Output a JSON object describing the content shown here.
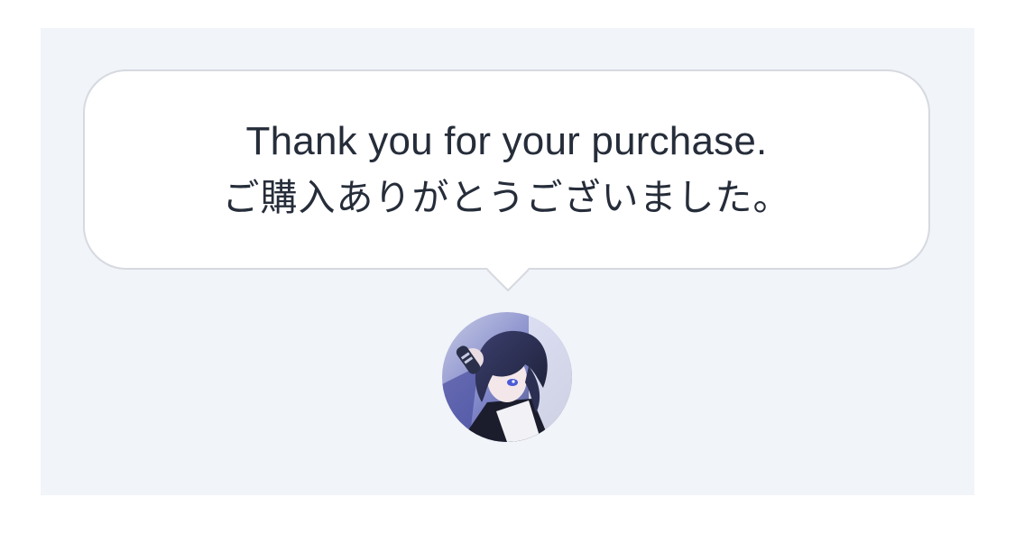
{
  "message": {
    "line_en": "Thank you for your purchase.",
    "line_ja": "ご購入ありがとうございました。"
  },
  "avatar": {
    "icon": "character-avatar-icon",
    "colors": {
      "dark": "#2a2f4a",
      "accent": "#6d6fd8",
      "light": "#e8eaf6"
    }
  },
  "colors": {
    "panel_bg": "#f1f4f8",
    "bubble_bg": "#ffffff",
    "bubble_border": "#d6d9e0",
    "text": "#262d3a"
  }
}
